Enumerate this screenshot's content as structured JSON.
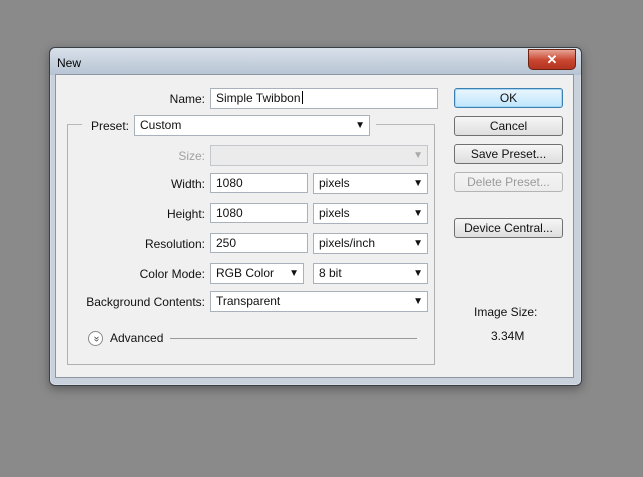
{
  "dialog": {
    "title": "New",
    "close_glyph": "✕",
    "name_label": "Name:",
    "name_value": "Simple Twibbon",
    "preset_label": "Preset:",
    "preset_value": "Custom",
    "size_label": "Size:",
    "size_value": "",
    "width_label": "Width:",
    "width_value": "1080",
    "width_unit": "pixels",
    "height_label": "Height:",
    "height_value": "1080",
    "height_unit": "pixels",
    "resolution_label": "Resolution:",
    "resolution_value": "250",
    "resolution_unit": "pixels/inch",
    "color_mode_label": "Color Mode:",
    "color_mode_value": "RGB Color",
    "bit_depth_value": "8 bit",
    "background_label": "Background Contents:",
    "background_value": "Transparent",
    "advanced_label": "Advanced",
    "advanced_icon": "chevron-double-down-icon",
    "buttons": {
      "ok": "OK",
      "cancel": "Cancel",
      "save_preset": "Save Preset...",
      "delete_preset": "Delete Preset...",
      "device_central": "Device Central..."
    },
    "image_size_label": "Image Size:",
    "image_size_value": "3.34M",
    "dropdown_arrow": "▼",
    "advanced_glyph": "»"
  },
  "colors": {
    "desktop": "#8a8a8a",
    "client_bg": "#f0f0f0",
    "close_red": "#c8452f",
    "default_button_border": "#3c7fb1"
  }
}
